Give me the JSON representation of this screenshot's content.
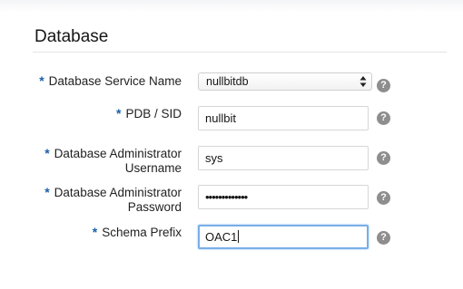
{
  "section": {
    "title": "Database"
  },
  "required_marker": "*",
  "help_glyph": "?",
  "fields": {
    "service_name": {
      "label": "Database Service Name",
      "selected_value": "nullbitdb"
    },
    "pdb_sid": {
      "label": "PDB / SID",
      "value": "nullbit"
    },
    "admin_username": {
      "label_line1": "Database Administrator",
      "label_line2": "Username",
      "value": "sys"
    },
    "admin_password": {
      "label_line1": "Database Administrator",
      "label_line2": "Password",
      "value": "•••••••••••••"
    },
    "schema_prefix": {
      "label": "Schema Prefix",
      "value": "OAC1"
    }
  },
  "colors": {
    "required_asterisk": "#1a5fa8",
    "focus_border": "#78aee8",
    "help_icon": "#8e8e8e"
  }
}
